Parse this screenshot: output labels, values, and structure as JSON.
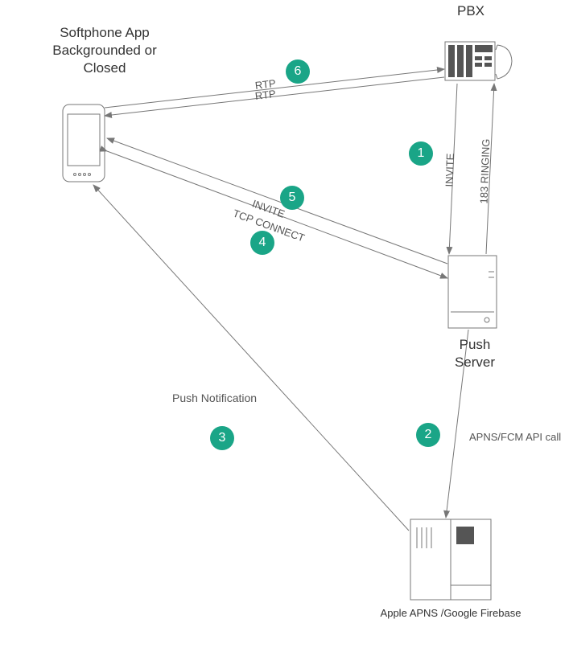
{
  "nodes": {
    "softphone": {
      "label_line1": "Softphone App",
      "label_line2": "Backgrounded or",
      "label_line3": "Closed"
    },
    "pbx": {
      "label": "PBX"
    },
    "push_server": {
      "label_line1": "Push",
      "label_line2": "Server"
    },
    "apns": {
      "label": "Apple APNS /Google Firebase"
    }
  },
  "edges": {
    "rtp_top": "RTP",
    "rtp_bottom": "RTP",
    "invite_pbx_push": "INVITE",
    "ringing_push_pbx": "183 RINGING",
    "invite_push_phone": "INVITE",
    "tcp_connect": "TCP CONNECT",
    "apns_api": "APNS/FCM API call",
    "push_notification": "Push Notification"
  },
  "steps": {
    "s1": "1",
    "s2": "2",
    "s3": "3",
    "s4": "4",
    "s5": "5",
    "s6": "6"
  }
}
